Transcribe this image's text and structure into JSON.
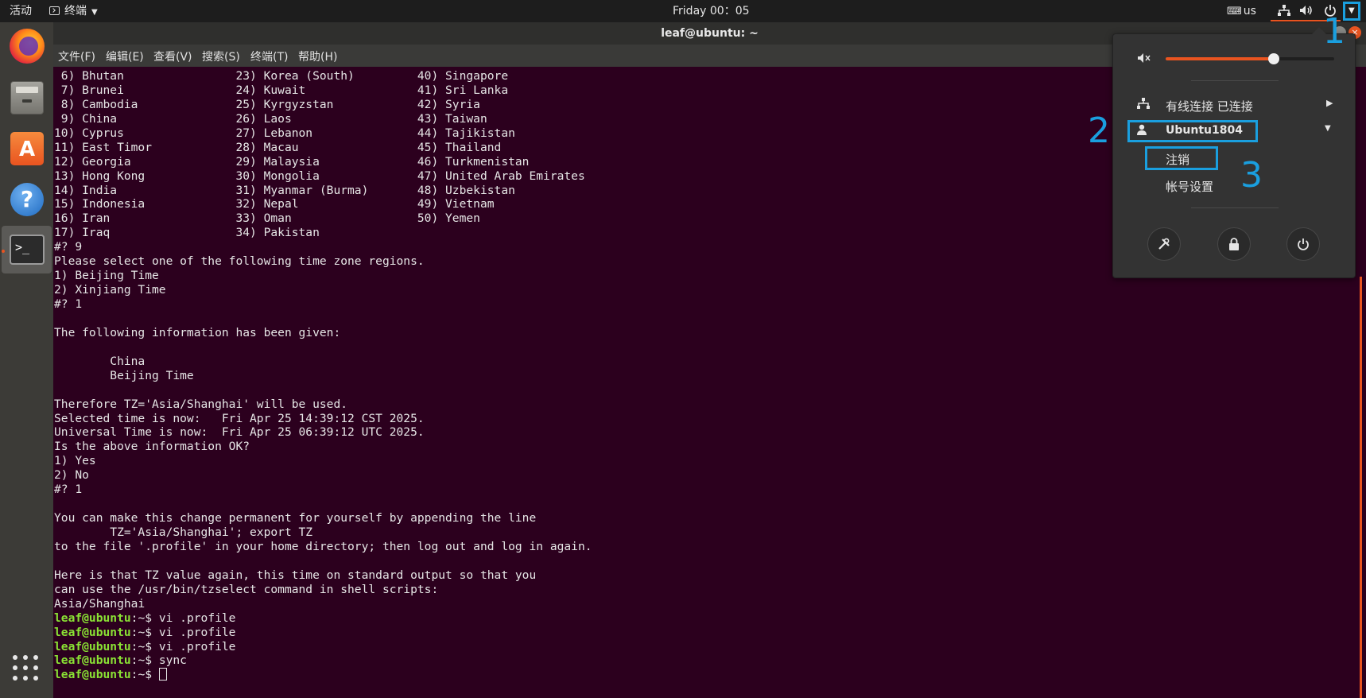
{
  "topbar": {
    "activities": "活动",
    "app_menu": "终端",
    "clock": "Friday 00：05",
    "keyboard": "us",
    "accent_color": "#e95420"
  },
  "window": {
    "title": "leaf@ubuntu: ~",
    "menu": [
      "文件(F)",
      "编辑(E)",
      "查看(V)",
      "搜索(S)",
      "终端(T)",
      "帮助(H)"
    ]
  },
  "dock": {
    "apps": [
      "firefox-icon",
      "files-icon",
      "software-icon",
      "help-icon",
      "terminal-icon",
      "show-apps-icon"
    ]
  },
  "terminal": {
    "lines": [
      " 6) Bhutan                23) Korea (South)         40) Singapore",
      " 7) Brunei                24) Kuwait                41) Sri Lanka",
      " 8) Cambodia              25) Kyrgyzstan            42) Syria",
      " 9) China                 26) Laos                  43) Taiwan",
      "10) Cyprus                27) Lebanon               44) Tajikistan",
      "11) East Timor            28) Macau                 45) Thailand",
      "12) Georgia               29) Malaysia              46) Turkmenistan",
      "13) Hong Kong             30) Mongolia              47) United Arab Emirates",
      "14) India                 31) Myanmar (Burma)       48) Uzbekistan",
      "15) Indonesia             32) Nepal                 49) Vietnam",
      "16) Iran                  33) Oman                  50) Yemen",
      "17) Iraq                  34) Pakistan",
      "#? 9",
      "Please select one of the following time zone regions.",
      "1) Beijing Time",
      "2) Xinjiang Time",
      "#? 1",
      "",
      "The following information has been given:",
      "",
      "        China",
      "        Beijing Time",
      "",
      "Therefore TZ='Asia/Shanghai' will be used.",
      "Selected time is now:   Fri Apr 25 14:39:12 CST 2025.",
      "Universal Time is now:  Fri Apr 25 06:39:12 UTC 2025.",
      "Is the above information OK?",
      "1) Yes",
      "2) No",
      "#? 1",
      "",
      "You can make this change permanent for yourself by appending the line",
      "        TZ='Asia/Shanghai'; export TZ",
      "to the file '.profile' in your home directory; then log out and log in again.",
      "",
      "Here is that TZ value again, this time on standard output so that you",
      "can use the /usr/bin/tzselect command in shell scripts:",
      "Asia/Shanghai"
    ],
    "prompt_user": "leaf@ubuntu",
    "prompt_suffix": ":~$ ",
    "commands": [
      "vi .profile",
      "vi .profile",
      "vi .profile",
      "sync",
      ""
    ],
    "prompt_color": "#8ae234",
    "background": "#2c001e"
  },
  "system_menu": {
    "volume_fraction": 0.64,
    "network_label": "有线连接 已连接",
    "user_name": "Ubuntu1804",
    "logout": "注销",
    "account_settings": "帐号设置",
    "buttons": [
      "settings-icon",
      "lock-icon",
      "power-icon"
    ]
  },
  "annotations": {
    "n1": "1",
    "n2": "2",
    "n3": "3",
    "color": "#1a9fdf"
  }
}
